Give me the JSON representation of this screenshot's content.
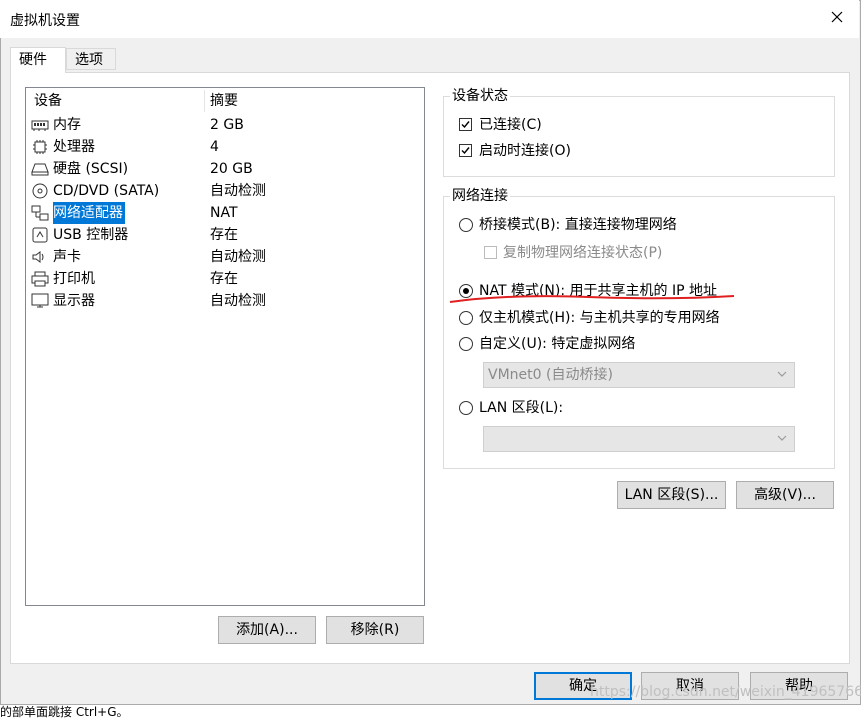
{
  "window": {
    "title": "虚拟机设置"
  },
  "tabs": [
    {
      "label": "硬件"
    },
    {
      "label": "选项"
    }
  ],
  "device_list": {
    "headers": {
      "device": "设备",
      "summary": "摘要"
    },
    "rows": [
      {
        "name": "内存",
        "summary": "2 GB",
        "icon": "memory-icon"
      },
      {
        "name": "处理器",
        "summary": "4",
        "icon": "processor-icon"
      },
      {
        "name": "硬盘 (SCSI)",
        "summary": "20 GB",
        "icon": "hard-disk-icon"
      },
      {
        "name": "CD/DVD (SATA)",
        "summary": "自动检测",
        "icon": "cd-dvd-icon"
      },
      {
        "name": "网络适配器",
        "summary": "NAT",
        "icon": "network-adapter-icon",
        "selected": true
      },
      {
        "name": "USB 控制器",
        "summary": "存在",
        "icon": "usb-icon"
      },
      {
        "name": "声卡",
        "summary": "自动检测",
        "icon": "sound-icon"
      },
      {
        "name": "打印机",
        "summary": "存在",
        "icon": "printer-icon"
      },
      {
        "name": "显示器",
        "summary": "自动检测",
        "icon": "display-icon"
      }
    ],
    "add_button": "添加(A)...",
    "remove_button": "移除(R)"
  },
  "device_status": {
    "title": "设备状态",
    "connected": {
      "label": "已连接(C)",
      "checked": true
    },
    "connect_at_power_on": {
      "label": "启动时连接(O)",
      "checked": true
    }
  },
  "network_connection": {
    "title": "网络连接",
    "bridged": {
      "label": "桥接模式(B): 直接连接物理网络",
      "selected": false
    },
    "replicate": {
      "label": "复制物理网络连接状态(P)",
      "checked": false
    },
    "nat": {
      "label": "NAT 模式(N): 用于共享主机的 IP 地址",
      "selected": true
    },
    "host_only": {
      "label": "仅主机模式(H): 与主机共享的专用网络",
      "selected": false
    },
    "custom": {
      "label": "自定义(U): 特定虚拟网络",
      "selected": false
    },
    "custom_select_value": "VMnet0 (自动桥接)",
    "lan_segment": {
      "label": "LAN 区段(L):",
      "selected": false
    },
    "lan_select_value": ""
  },
  "action_buttons": {
    "lan_segments": "LAN 区段(S)...",
    "advanced": "高级(V)..."
  },
  "footer": {
    "ok": "确定",
    "cancel": "取消",
    "help": "帮助"
  },
  "watermark": "https://blog.csdn.net/weixin_41965766",
  "bottom_text": "的部单面跳接 Ctrl+G。",
  "colors": {
    "selection": "#0078d7",
    "annotation": "#e02020"
  }
}
